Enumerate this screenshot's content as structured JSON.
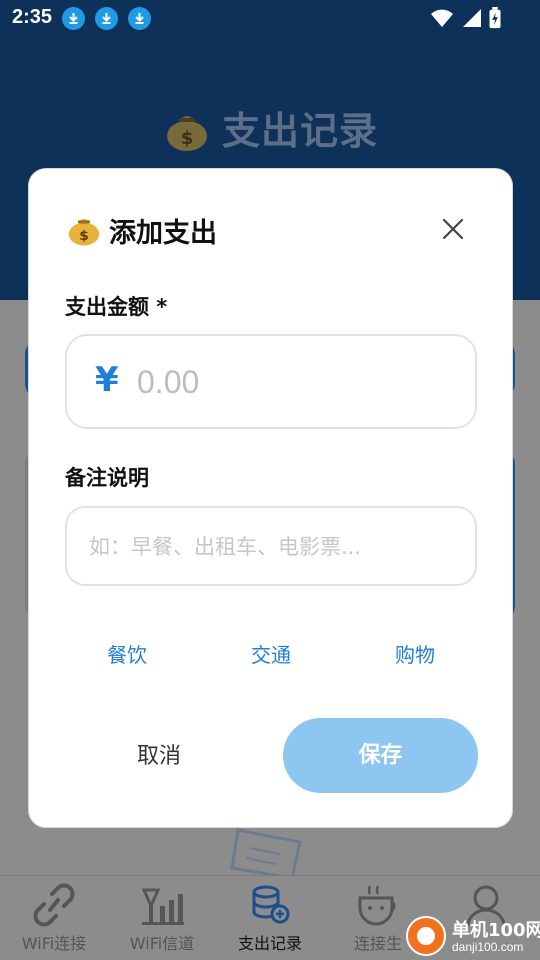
{
  "status_bar": {
    "time": "2:35"
  },
  "app": {
    "header_title": "支出记录"
  },
  "bottom_nav": {
    "items": [
      {
        "label": "WiFi连接",
        "icon": "link-icon"
      },
      {
        "label": "WiFi信道",
        "icon": "signal-bars-icon"
      },
      {
        "label": "支出记录",
        "icon": "coin-stack-icon"
      },
      {
        "label": "连接生",
        "icon": "coffee-cup-icon"
      },
      {
        "label": "",
        "icon": "person-icon"
      }
    ],
    "active_index": 2
  },
  "dialog": {
    "title": "添加支出",
    "amount_label": "支出金额 *",
    "currency_symbol": "¥",
    "amount_placeholder": "0.00",
    "note_label": "备注说明",
    "note_placeholder": "如：早餐、出租车、电影票...",
    "quick_tags": [
      "餐饮",
      "交通",
      "购物"
    ],
    "cancel_label": "取消",
    "save_label": "保存"
  },
  "watermark": {
    "text": "单机100网",
    "url": "danji100.com"
  },
  "colors": {
    "accent": "#1e7fd6",
    "save_button": "#8ec6f2",
    "header_bg": "#0d3158"
  }
}
